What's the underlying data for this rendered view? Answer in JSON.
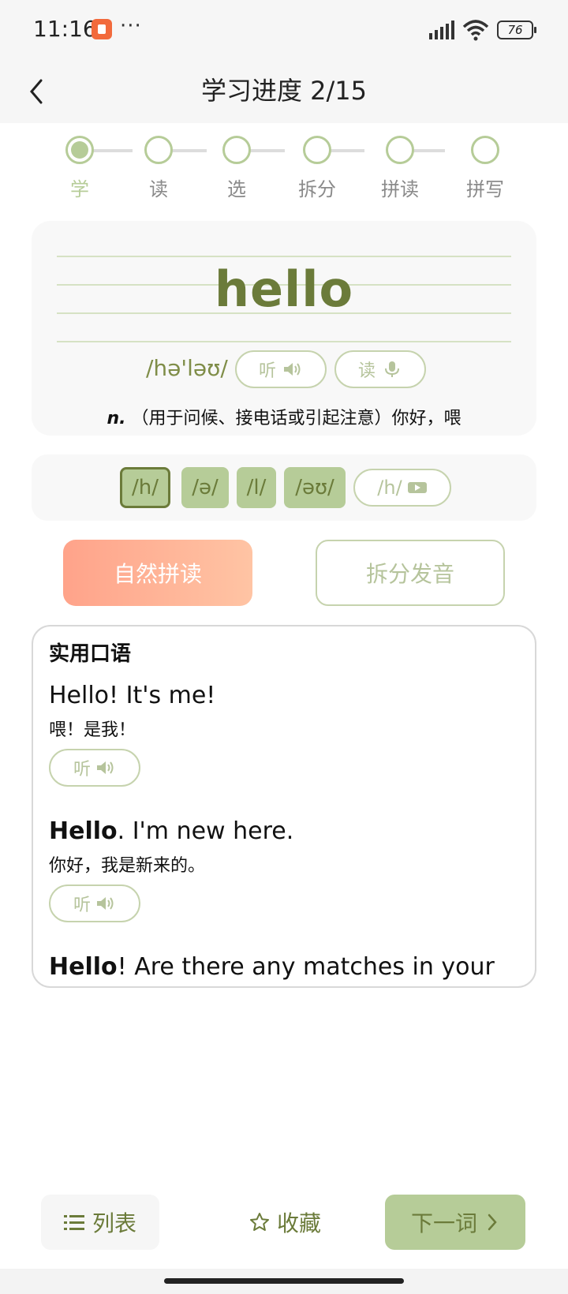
{
  "status_bar": {
    "time": "11:16",
    "dots": "···",
    "battery": "76"
  },
  "header": {
    "title": "学习进度 2/15"
  },
  "steps": [
    {
      "label": "学",
      "active": true
    },
    {
      "label": "读",
      "active": false
    },
    {
      "label": "选",
      "active": false
    },
    {
      "label": "拆分",
      "active": false
    },
    {
      "label": "拼读",
      "active": false
    },
    {
      "label": "拼写",
      "active": false
    }
  ],
  "word": {
    "text": "hello",
    "phonetic": "/hə'ləʊ/",
    "listen_label": "听",
    "read_label": "读",
    "pos": "n.",
    "definition": "（用于问候、接电话或引起注意）你好，喂"
  },
  "phonemes": [
    {
      "label": "/h/",
      "selected": true
    },
    {
      "label": "/ə/",
      "selected": false
    },
    {
      "label": "/l/",
      "selected": false
    },
    {
      "label": "/əʊ/",
      "selected": false
    }
  ],
  "phoneme_video_label": "/h/",
  "modes": {
    "natural_phonics": "自然拼读",
    "split_pronounce": "拆分发音"
  },
  "spoken": {
    "title": "实用口语",
    "sentences": [
      {
        "bold": "",
        "rest": "Hello! It's me!",
        "zh": "喂！是我！",
        "listen": "听"
      },
      {
        "bold": "Hello",
        "rest": ". I'm new here.",
        "zh": "你好，我是新来的。",
        "listen": "听"
      },
      {
        "bold": "Hello",
        "rest": "! Are there any matches in your",
        "zh": "",
        "listen": ""
      }
    ]
  },
  "bottom": {
    "list_label": "列表",
    "favorite_label": "收藏",
    "next_label": "下一词"
  },
  "colors": {
    "accent": "#b6cc98",
    "accent_dark": "#6b7b3a",
    "orange": "#ffa38a"
  }
}
